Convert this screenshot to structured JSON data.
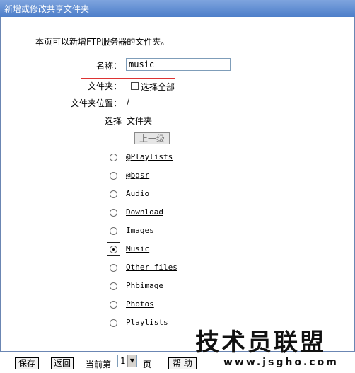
{
  "window": {
    "title": "新增或修改共享文件夹"
  },
  "description": "本页可以新增FTP服务器的文件夹。",
  "form": {
    "name_label": "名称：",
    "name_value": "music",
    "folder_label": "文件夹：",
    "select_all_label": "选择全部",
    "select_all_checked": false,
    "location_label": "文件夹位置：",
    "location_value": "/",
    "col_select": "选择",
    "col_folder": "文件夹",
    "up_button": "上一级"
  },
  "folders": [
    {
      "name": "@Playlists",
      "selected": false
    },
    {
      "name": "@bgsr",
      "selected": false
    },
    {
      "name": "Audio",
      "selected": false
    },
    {
      "name": "Download",
      "selected": false
    },
    {
      "name": "Images",
      "selected": false
    },
    {
      "name": "Music",
      "selected": true
    },
    {
      "name": "Other files",
      "selected": false
    },
    {
      "name": "Phbimage",
      "selected": false
    },
    {
      "name": "Photos",
      "selected": false
    },
    {
      "name": "Playlists",
      "selected": false
    }
  ],
  "footer": {
    "save": "保存",
    "back": "返回",
    "current_page_prefix": "当前第",
    "current_page": "1",
    "page_suffix": "页",
    "help": "帮 助"
  },
  "watermark": {
    "main": "技术员联盟",
    "url": "www.jsgho.com"
  }
}
